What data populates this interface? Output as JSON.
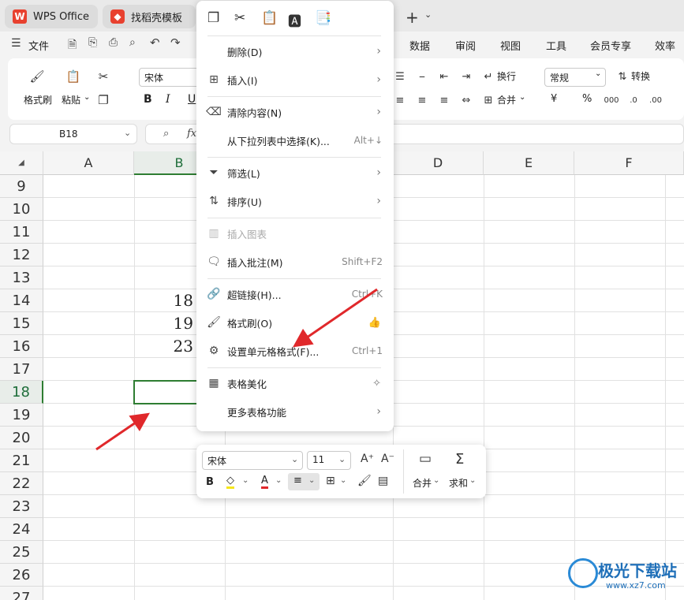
{
  "tabs": [
    {
      "label": "WPS Office"
    },
    {
      "label": "找稻壳模板"
    }
  ],
  "menu": {
    "file": "文件",
    "data": "数据",
    "review": "审阅",
    "view": "视图",
    "tools": "工具",
    "vip": "会员专享",
    "efficiency": "效率"
  },
  "ribbon": {
    "format_painter": "格式刷",
    "paste": "粘贴",
    "font_name": "宋体",
    "wrap": "换行",
    "number_format": "常规",
    "convert": "转换",
    "merge": "合并",
    "bold": "B",
    "italic": "I",
    "underline": "U",
    "yen": "¥",
    "percent": "%"
  },
  "formula_bar": {
    "name_box": "B18",
    "fx": "fx"
  },
  "grid": {
    "columns": [
      "A",
      "B",
      "C",
      "D",
      "E",
      "F"
    ],
    "rows": [
      "9",
      "10",
      "11",
      "12",
      "13",
      "14",
      "15",
      "16",
      "17",
      "18",
      "19",
      "20",
      "21",
      "22",
      "23",
      "24",
      "25",
      "26",
      "27"
    ],
    "values": [
      {
        "row": "14",
        "col": "B",
        "value": "18"
      },
      {
        "row": "15",
        "col": "B",
        "value": "19"
      },
      {
        "row": "16",
        "col": "B",
        "value": "23"
      }
    ],
    "selected_cell": "B18"
  },
  "context_menu": {
    "items": [
      {
        "label": "删除(D)",
        "submenu": true
      },
      {
        "label": "插入(I)",
        "submenu": true
      },
      {
        "label": "清除内容(N)",
        "submenu": true
      },
      {
        "label": "从下拉列表中选择(K)...",
        "shortcut": "Alt+↓"
      },
      {
        "label": "筛选(L)",
        "submenu": true
      },
      {
        "label": "排序(U)",
        "submenu": true
      },
      {
        "label": "插入图表",
        "disabled": true
      },
      {
        "label": "插入批注(M)",
        "shortcut": "Shift+F2"
      },
      {
        "label": "超链接(H)...",
        "shortcut": "Ctrl+K"
      },
      {
        "label": "格式刷(O)"
      },
      {
        "label": "设置单元格格式(F)...",
        "shortcut": "Ctrl+1"
      },
      {
        "label": "表格美化"
      },
      {
        "label": "更多表格功能",
        "submenu": true
      }
    ]
  },
  "mini_toolbar": {
    "font_name": "宋体",
    "font_size": "11",
    "bold": "B",
    "merge": "合并",
    "sum": "求和"
  },
  "watermark": {
    "text": "极光下载站",
    "url": "www.xz7.com"
  },
  "colors": {
    "accent_green": "#2e7d32",
    "arrow_red": "#e0282b",
    "wps_red": "#e8412f"
  }
}
